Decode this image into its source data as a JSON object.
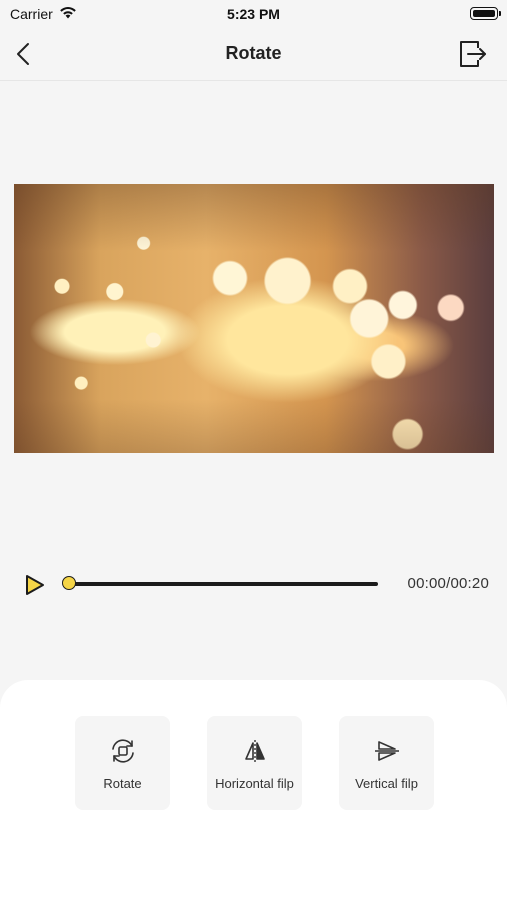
{
  "status_bar": {
    "carrier": "Carrier",
    "time": "5:23 PM",
    "wifi_icon": "wifi-icon",
    "battery_icon": "battery-icon"
  },
  "nav": {
    "title": "Rotate",
    "back_icon": "chevron-left-icon",
    "export_icon": "export-icon"
  },
  "player": {
    "current_time": "00:00",
    "total_time": "00:20",
    "time_display": "00:00/00:20",
    "progress": 0,
    "play_icon": "play-icon"
  },
  "tools": [
    {
      "label": "Rotate",
      "icon": "rotate-icon"
    },
    {
      "label": "Horizontal filp",
      "icon": "horizontal-flip-icon"
    },
    {
      "label": "Vertical filp",
      "icon": "vertical-flip-icon"
    }
  ],
  "colors": {
    "accent": "#f5d547",
    "background": "#f5f5f5",
    "panel": "#ffffff",
    "text": "#222222"
  }
}
